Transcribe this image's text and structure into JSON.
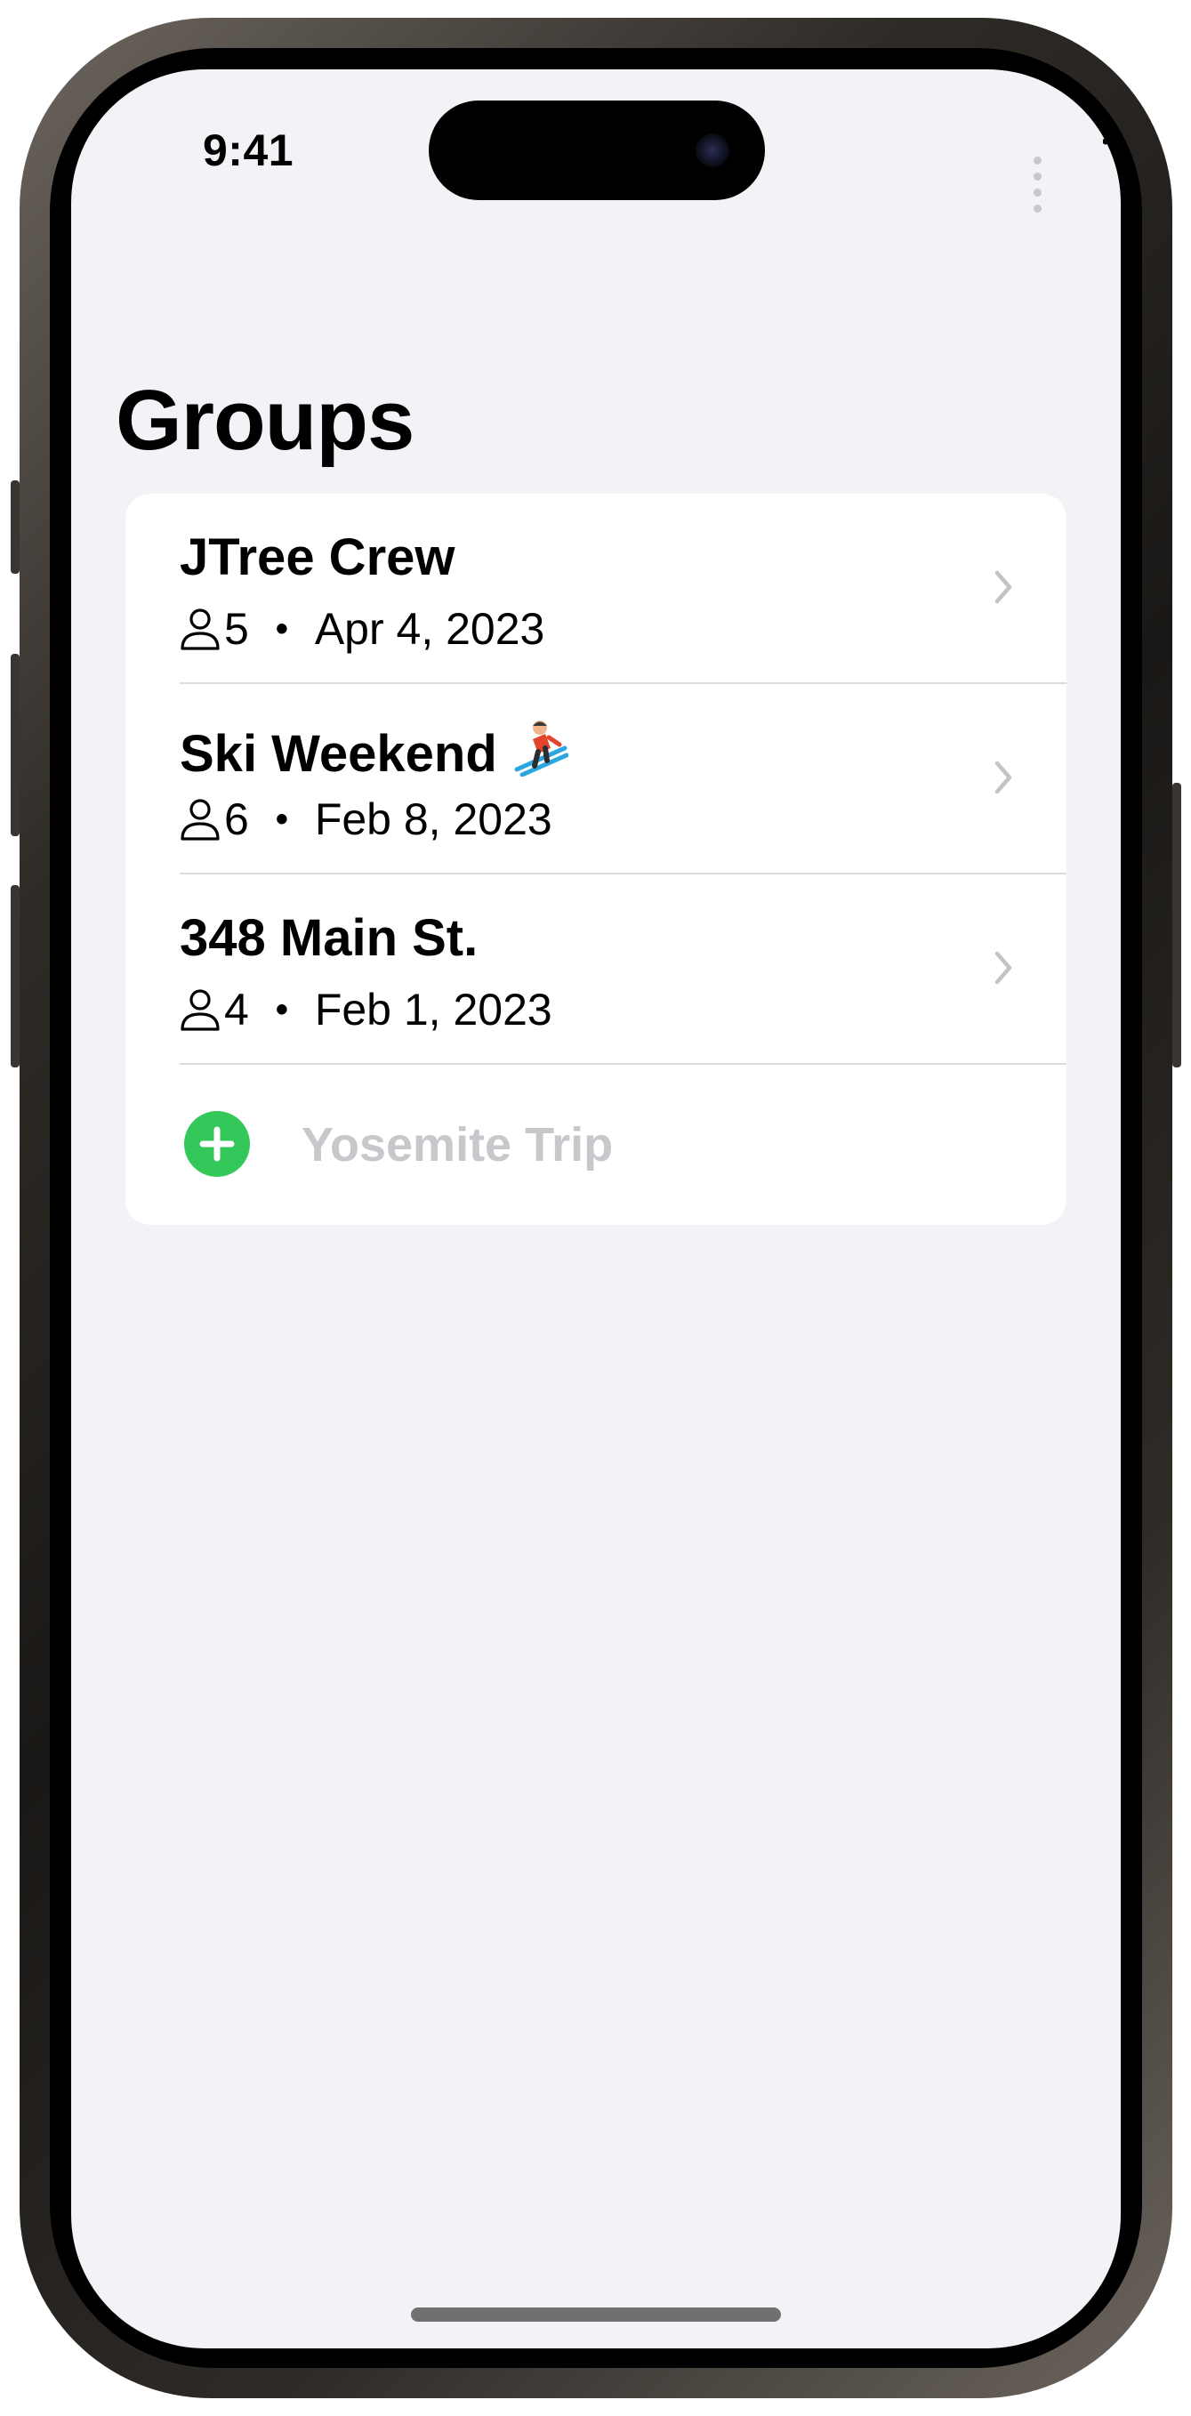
{
  "status_bar": {
    "time": "9:41"
  },
  "page": {
    "title": "Groups"
  },
  "groups": [
    {
      "name": "JTree Crew",
      "members": "5",
      "separator": "•",
      "date": "Apr 4, 2023"
    },
    {
      "name": "Ski Weekend",
      "members": "6",
      "separator": "•",
      "date": "Feb 8, 2023"
    },
    {
      "name": "348 Main St.",
      "members": "4",
      "separator": "•",
      "date": "Feb 1, 2023"
    }
  ],
  "new_group": {
    "placeholder": "Yosemite Trip",
    "value": ""
  },
  "icons": {
    "status": [
      "cellular-signal-icon",
      "wifi-icon",
      "battery-icon"
    ],
    "row": [
      "person-icon",
      "chevron-right-icon"
    ],
    "emoji": "skier-emoji",
    "add": "plus-circle-icon"
  },
  "colors": {
    "background": "#f2f2f7",
    "card": "#ffffff",
    "add_button": "#34c759",
    "chevron": "#c4c4c7",
    "placeholder": "#c7c7cc"
  }
}
